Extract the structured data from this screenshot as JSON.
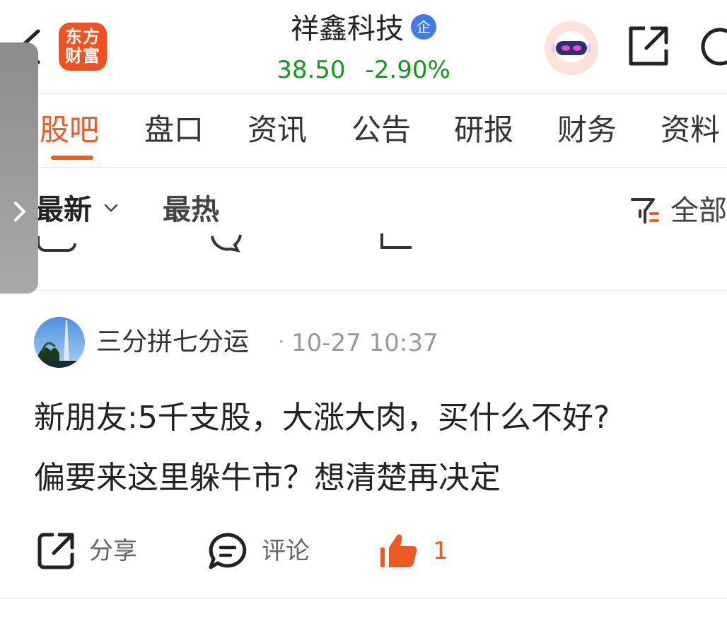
{
  "header": {
    "logo_line1": "东方",
    "logo_line2": "财富",
    "stock_name": "祥鑫科技",
    "badge": "企",
    "price": "38.50",
    "change_pct": "-2.90%",
    "price_color": "#0f9b1d"
  },
  "tabs": [
    {
      "label": "股吧",
      "active": true
    },
    {
      "label": "盘口"
    },
    {
      "label": "资讯"
    },
    {
      "label": "公告"
    },
    {
      "label": "研报"
    },
    {
      "label": "财务"
    },
    {
      "label": "资料"
    }
  ],
  "sort": {
    "latest": "最新",
    "hot": "最热",
    "filter": "全部"
  },
  "post": {
    "author": "三分拼七分运",
    "separator": "·",
    "time": "10-27 10:37",
    "line1": "新朋友:5千支股，大涨大肉，买什么不好?",
    "line2": "偏要来这里躲牛市？想清楚再决定",
    "share_label": "分享",
    "comment_label": "评论",
    "like_count": "1"
  },
  "colors": {
    "accent": "#ee5a24",
    "brand": "#f2511e",
    "price_down": "#0f9b1d"
  },
  "icons": [
    "back-icon",
    "robot-assistant-icon",
    "share-icon",
    "search-icon",
    "chevron-down-icon",
    "filter-icon",
    "comment-icon",
    "thumbs-up-icon",
    "chevron-right-icon"
  ]
}
